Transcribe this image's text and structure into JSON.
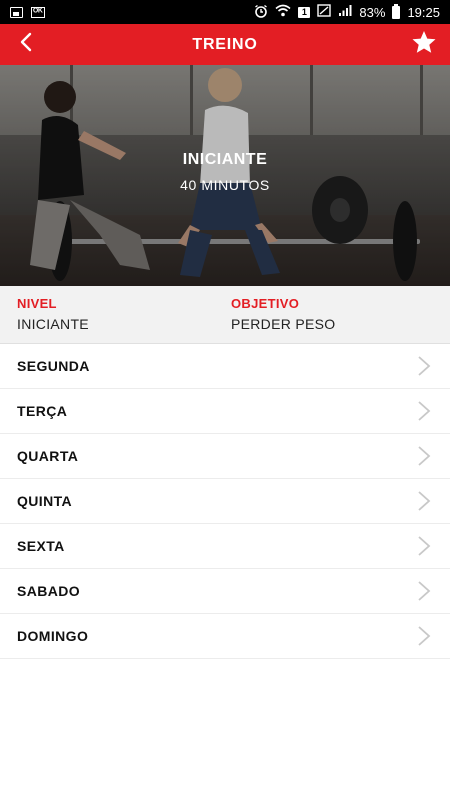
{
  "status_bar": {
    "battery": "83%",
    "time": "19:25",
    "sim_label": "1",
    "icons": [
      "gallery-icon",
      "key-icon",
      "alarm-icon",
      "wifi-icon",
      "sim-icon",
      "signal-icon",
      "battery-icon"
    ]
  },
  "header": {
    "title": "TREINO",
    "back_icon": "back-chevron-icon",
    "favorite_icon": "star-icon",
    "color": "#e31e24"
  },
  "hero": {
    "title": "INICIANTE",
    "subtitle": "40 MINUTOS"
  },
  "info": {
    "nivel_label": "NIVEL",
    "nivel_value": "INICIANTE",
    "objetivo_label": "OBJETIVO",
    "objetivo_value": "PERDER PESO"
  },
  "days": [
    {
      "label": "SEGUNDA"
    },
    {
      "label": "TERÇA"
    },
    {
      "label": "QUARTA"
    },
    {
      "label": "QUINTA"
    },
    {
      "label": "SEXTA"
    },
    {
      "label": "SABADO"
    },
    {
      "label": "DOMINGO"
    }
  ],
  "colors": {
    "accent": "#e31e24",
    "chevron": "#c8c8c8"
  }
}
